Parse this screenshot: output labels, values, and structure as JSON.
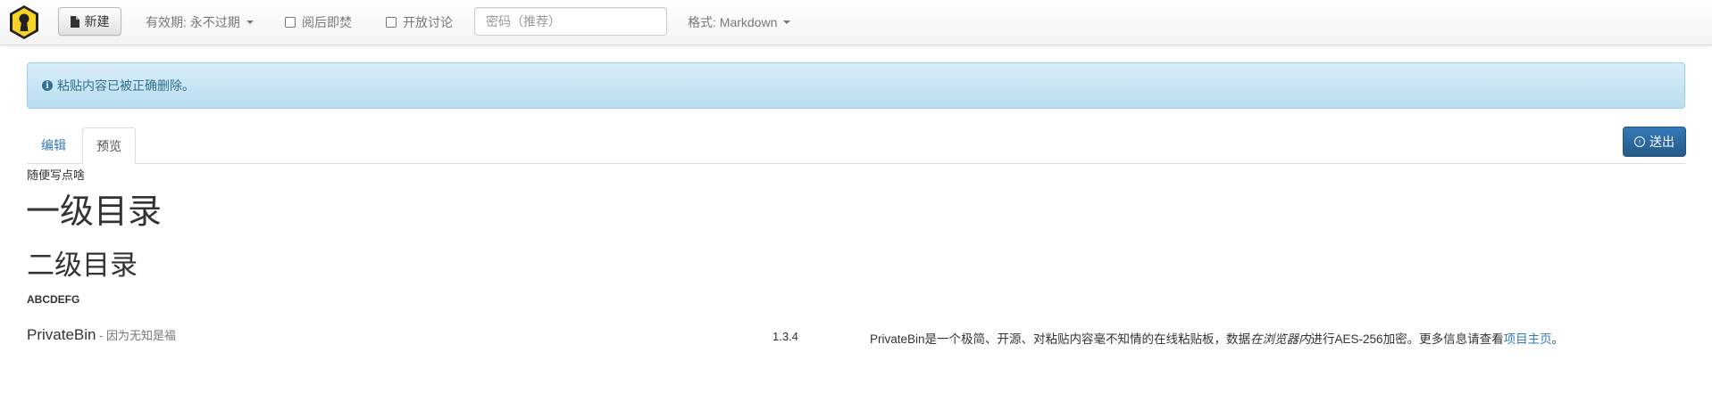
{
  "navbar": {
    "new_button": "新建",
    "expiration": "有效期: 永不过期",
    "burn_after_reading": "阅后即焚",
    "open_discussion": "开放讨论",
    "password_placeholder": "密码（推荐）",
    "format": "格式: Markdown"
  },
  "alert": {
    "message": "粘贴内容已被正确删除。"
  },
  "tabs": {
    "edit": "编辑",
    "preview": "预览",
    "active": "预览"
  },
  "send_button": "送出",
  "preview": {
    "intro": "随便写点啥",
    "heading1": "一级目录",
    "heading2": "二级目录",
    "heading6": "ABCDEFG"
  },
  "footer": {
    "brand_name": "PrivateBin",
    "brand_tagline": " - 因为无知是福",
    "version": "1.3.4",
    "about_before": "PrivateBin是一个极简、开源、对粘贴内容毫不知情的在线粘贴板，数据",
    "about_em": "在浏览器内",
    "about_after": "进行AES-256加密。更多信息请查看",
    "about_link": "项目主页",
    "about_end": "。"
  },
  "colors": {
    "link": "#337ab7",
    "alert_text": "#31708f",
    "alert_bg": "#d9edf7",
    "primary_button": "#337ab7",
    "logo_yellow": "#f5d327"
  },
  "icons": {
    "logo": "privatebin-keyhole-logo",
    "new": "file-icon",
    "alert": "info-sign-icon",
    "send": "upload-circle-icon"
  }
}
